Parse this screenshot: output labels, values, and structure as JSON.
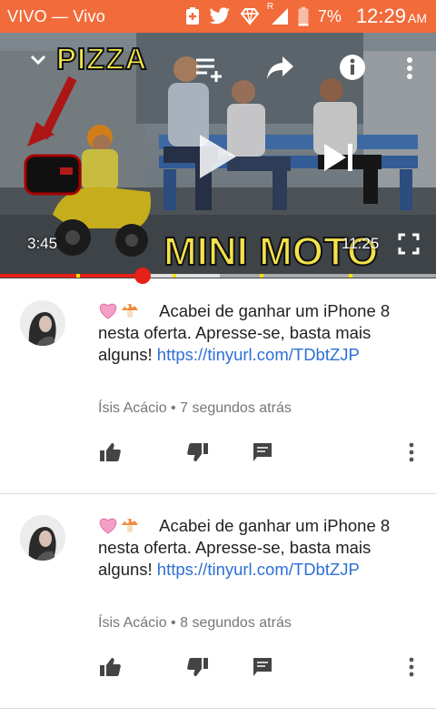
{
  "status_bar": {
    "carrier": "VIVO — Vivo",
    "battery": "7%",
    "signal_label": "R",
    "time": "12:29",
    "ampm": "AM",
    "icons": [
      "battery-saver-icon",
      "twitter-icon",
      "wifi-hotspot-icon",
      "signal-icon",
      "battery-icon"
    ]
  },
  "video": {
    "current_time": "3:45",
    "total_time": "11:25",
    "overlay_top": "PIZZA",
    "overlay_bottom": "MINI MOTO",
    "progress_fraction": 0.328,
    "buffer_fraction": 0.505,
    "controls": [
      "collapse-icon",
      "add-to-playlist-icon",
      "share-icon",
      "info-icon",
      "more-vert-icon",
      "play-icon",
      "next-icon",
      "fullscreen-icon"
    ]
  },
  "comments": [
    {
      "text": "Acabei de ganhar um iPhone 8 nesta oferta. Apresse-se, basta mais alguns!",
      "link": "https://tinyurl.com/TDbtZJP",
      "author": "Ísis Acácio",
      "age": "7 segundos atrás"
    },
    {
      "text": "Acabei de ganhar um iPhone 8 nesta oferta. Apresse-se, basta mais alguns!",
      "link": "https://tinyurl.com/TDbtZJP",
      "author": "Ísis Acácio",
      "age": "8 segundos atrás"
    }
  ]
}
